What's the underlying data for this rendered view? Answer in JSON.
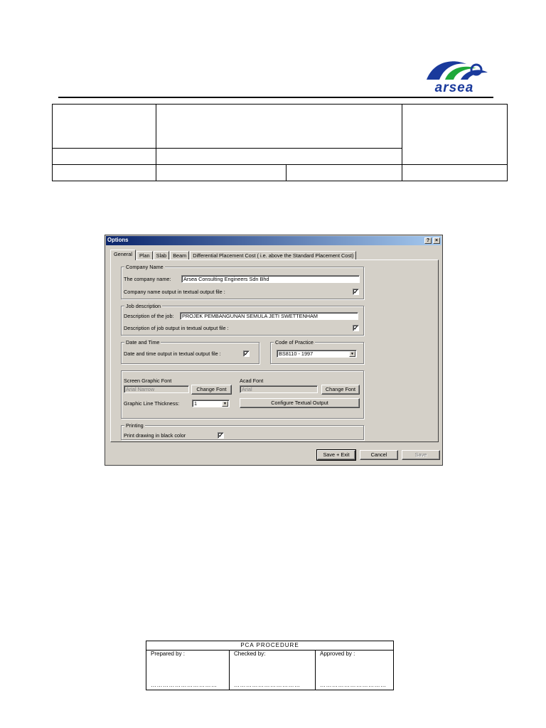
{
  "header": {
    "logo_text": "arsea",
    "brand_colors": {
      "blue": "#1a3a9c",
      "green": "#1fa83a"
    }
  },
  "dialog": {
    "title": "Options",
    "help_button": "?",
    "close_button": "×",
    "tabs": [
      {
        "label": "General",
        "active": true
      },
      {
        "label": "Plan",
        "active": false
      },
      {
        "label": "Slab",
        "active": false
      },
      {
        "label": "Beam",
        "active": false
      },
      {
        "label": "Differential Placement Cost ( i.e. above the Standard Placement Cost)",
        "active": false
      }
    ],
    "company": {
      "legend": "Company Name",
      "name_label": "The company name:",
      "name_value": "Arsea Consulting Engineers Sdn Bhd",
      "output_label": "Company name output in textual output file :",
      "output_checked": "✓"
    },
    "job": {
      "legend": "Job description",
      "desc_label": "Description of the job:",
      "desc_value": "PROJEK PEMBANGUNAN SEMULA JETI SWETTENHAM",
      "output_label": "Description of job output in textual output file :",
      "output_checked": "✓"
    },
    "datetime": {
      "legend": "Date and Time",
      "output_label": "Date and time output in textual output file :",
      "output_checked": "✓"
    },
    "code": {
      "legend": "Code of Practice",
      "value": "BS8110 - 1997"
    },
    "fonts": {
      "screen_label": "Screen Graphic Font",
      "screen_value": "Arial Narrow",
      "screen_button": "Change Font",
      "acad_label": "Acad Font",
      "acad_value": "Arial",
      "acad_button": "Change Font",
      "thickness_label": "Graphic Line Thickness:",
      "thickness_value": "1",
      "configure_button": "Configure Textual Output"
    },
    "printing": {
      "legend": "Printing",
      "label": "Print drawing in black color",
      "checked": "✓"
    },
    "buttons": {
      "save_exit": "Save + Exit",
      "cancel": "Cancel",
      "save": "Save"
    }
  },
  "footer": {
    "title": "PCA PROCEDURE",
    "prepared": "Prepared by :",
    "checked": "Checked by:",
    "approved": "Approved by :",
    "dots": "……………………………"
  }
}
